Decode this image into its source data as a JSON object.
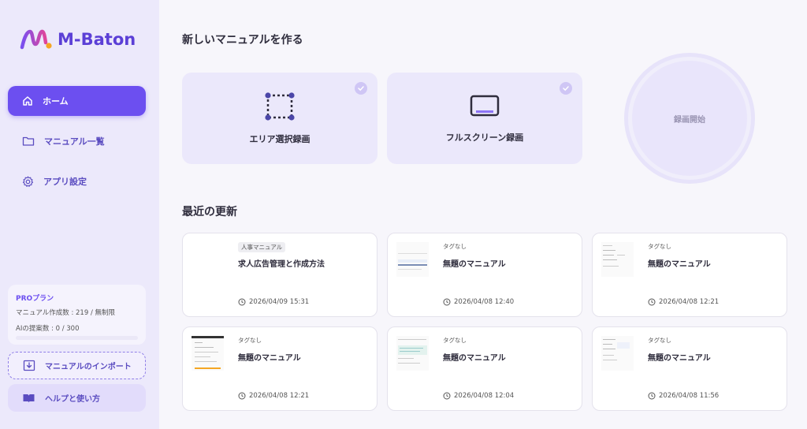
{
  "app": {
    "name": "M-Baton"
  },
  "sidebar": {
    "items": [
      {
        "label": "ホーム",
        "icon": "home-icon",
        "active": true
      },
      {
        "label": "マニュアル一覧",
        "icon": "folder-icon",
        "active": false
      },
      {
        "label": "アプリ設定",
        "icon": "gear-icon",
        "active": false
      }
    ],
    "plan": {
      "title": "PROプラン",
      "manual_count": "マニュアル作成数 : 219 / 無制限",
      "ai_count": "AIの提案数 : 0 / 300",
      "ai_usage_fraction": 0.0
    },
    "import_label": "マニュアルのインポート",
    "help_label": "ヘルプと使い方"
  },
  "main": {
    "new_title": "新しいマニュアルを作る",
    "modes": [
      {
        "label": "エリア選択録画",
        "icon": "area-select-icon"
      },
      {
        "label": "フルスクリーン録画",
        "icon": "fullscreen-icon"
      }
    ],
    "record_label": "録画開始",
    "recent_title": "最近の更新",
    "recent": [
      {
        "tag": "人事マニュアル",
        "title": "求人広告管理と作成方法",
        "date": "2026/04/09 15:31"
      },
      {
        "tag": "タグなし",
        "title": "無題のマニュアル",
        "date": "2026/04/08 12:40"
      },
      {
        "tag": "タグなし",
        "title": "無題のマニュアル",
        "date": "2026/04/08 12:21"
      },
      {
        "tag": "タグなし",
        "title": "無題のマニュアル",
        "date": "2026/04/08 12:21"
      },
      {
        "tag": "タグなし",
        "title": "無題のマニュアル",
        "date": "2026/04/08 12:04"
      },
      {
        "tag": "タグなし",
        "title": "無題のマニュアル",
        "date": "2026/04/08 11:56"
      }
    ]
  },
  "colors": {
    "accent": "#6c4ff0",
    "sidebar_bg": "#ece9fb",
    "card_bg": "#ebe8fb"
  }
}
